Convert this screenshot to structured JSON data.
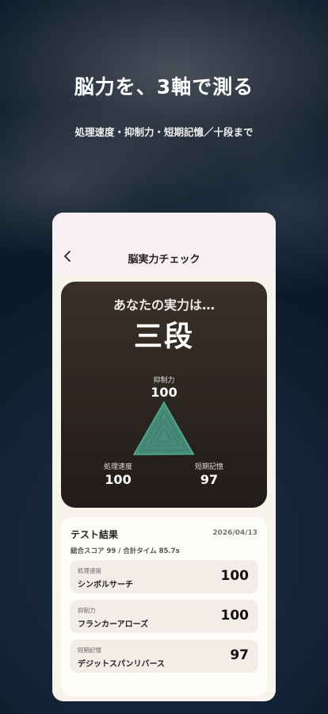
{
  "hero": {
    "title": "脳力を、3軸で測る",
    "subtitle": "処理速度・抑制力・短期記憶／十段まで"
  },
  "screen": {
    "title": "脳実力チェック",
    "back_icon": "chevron-left-icon"
  },
  "result": {
    "lead": "あなたの実力は…",
    "rank": "三段",
    "axes": [
      {
        "label": "抑制力",
        "value": "100",
        "score": 100
      },
      {
        "label": "処理速度",
        "value": "100",
        "score": 100
      },
      {
        "label": "短期記憶",
        "value": "97",
        "score": 97
      }
    ],
    "radar_color": "#4fae95"
  },
  "tests": {
    "title": "テスト結果",
    "date": "2026/04/13",
    "summary": "総合スコア 99 / 合計タイム 85.7s",
    "rows": [
      {
        "category": "処理速度",
        "name": "シンボルサーチ",
        "score": "100"
      },
      {
        "category": "抑制力",
        "name": "フランカーアローズ",
        "score": "100"
      },
      {
        "category": "短期記憶",
        "name": "デジットスパンリバース",
        "score": "97"
      }
    ]
  }
}
